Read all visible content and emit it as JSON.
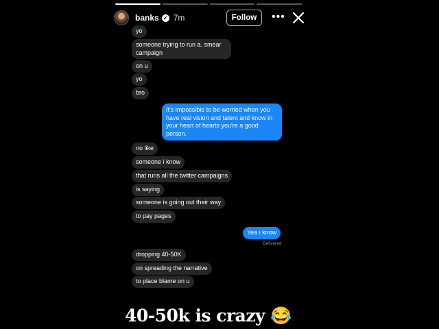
{
  "header": {
    "username": "banks",
    "verified_mark": "✓",
    "time": "7m",
    "follow_label": "Follow",
    "more_label": "•••",
    "progress_segments": 4,
    "progress_completed": 1
  },
  "messages": {
    "in_1": "yo",
    "in_2": "someone trying to run a. smear campaign",
    "in_3": "on u",
    "in_4": "yo",
    "in_5": "bro",
    "out_1": "It's impossible to be worried when you have real vision and talent and know in your heart of hearts you're a good person.",
    "in_6": "no like",
    "in_7": "someone i know",
    "in_8": "that runs all the twitter campaigns",
    "in_9": "is saying",
    "in_10": "someone is going out their way",
    "in_11": "to pay pages",
    "out_2": "Yea i know",
    "delivered": "Delivered",
    "in_12": "dropping 40-50K",
    "in_13": "on spreading the narrative",
    "in_14": "to place blame on u"
  },
  "caption": {
    "text": "40-50k is crazy 😂"
  },
  "colors": {
    "incoming_bubble": "#262628",
    "outgoing_bubble": "#1a86f7",
    "background": "#000000"
  },
  "icons": {
    "avatar": "avatar",
    "verified": "verified-badge-icon",
    "more": "more-options-icon",
    "close": "close-icon"
  }
}
